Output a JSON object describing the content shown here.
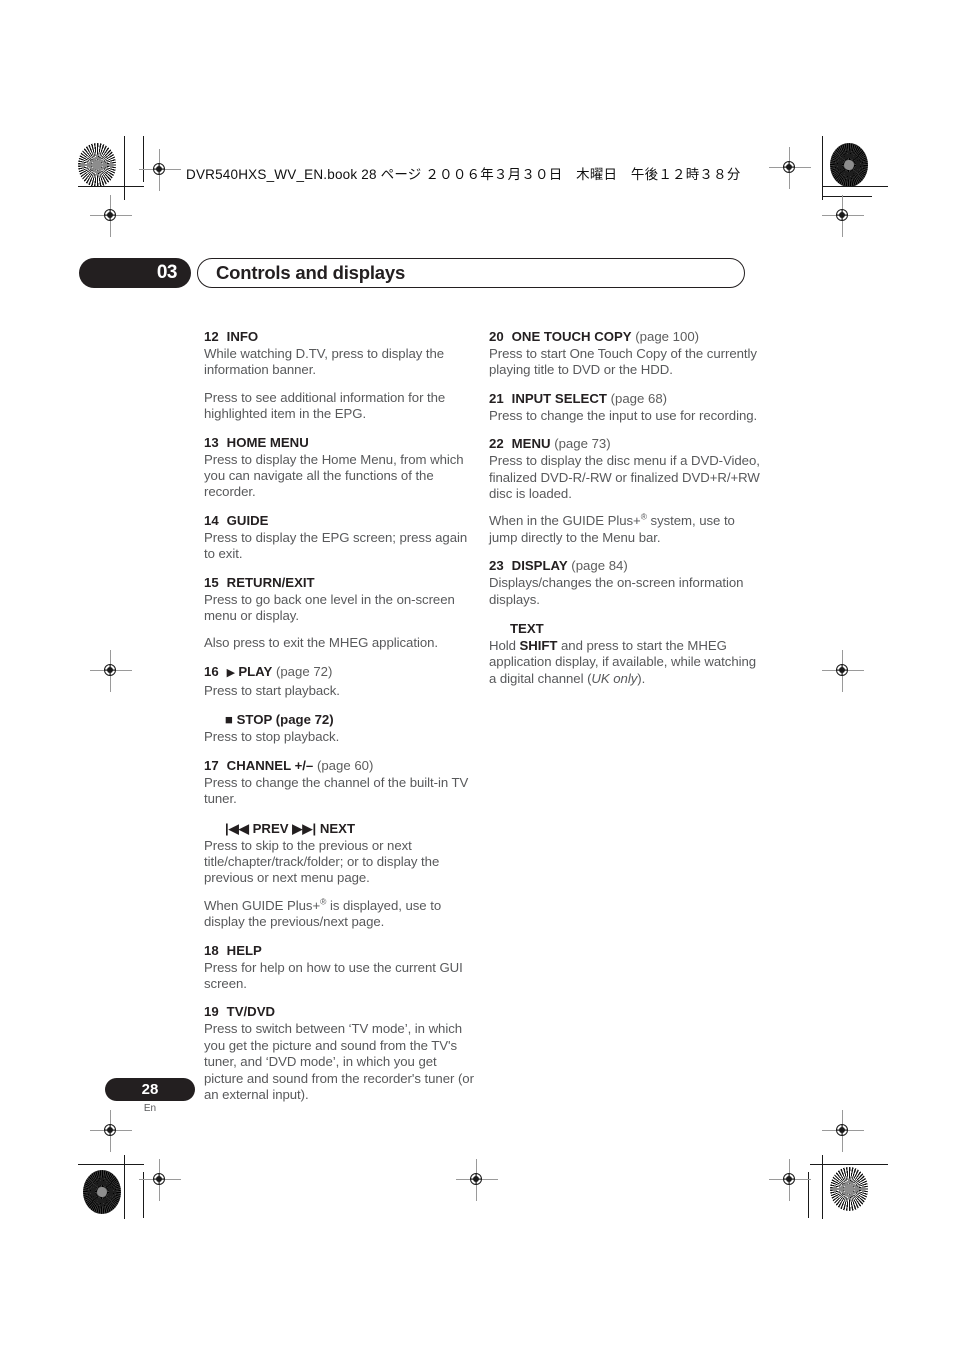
{
  "header": {
    "book_line": "DVR540HXS_WV_EN.book  28 ページ  ２００６年３月３０日　木曜日　午後１２時３８分"
  },
  "chapter": {
    "number": "03",
    "title": "Controls and displays"
  },
  "footer": {
    "page_number": "28",
    "language": "En"
  },
  "columns": {
    "left": [
      {
        "num": "12",
        "label": "INFO",
        "page_ref": "",
        "glyph": "",
        "indent": false,
        "paragraphs": [
          "While watching D.TV, press to display the information banner.",
          "Press to see additional information for the highlighted item in the EPG."
        ]
      },
      {
        "num": "13",
        "label": "HOME MENU",
        "page_ref": "",
        "glyph": "",
        "indent": false,
        "paragraphs": [
          "Press to display the Home Menu, from which you can navigate all the functions of the recorder."
        ]
      },
      {
        "num": "14",
        "label": "GUIDE",
        "page_ref": "",
        "glyph": "",
        "indent": false,
        "paragraphs": [
          "Press to display the EPG screen; press again to exit."
        ]
      },
      {
        "num": "15",
        "label": "RETURN/EXIT",
        "page_ref": "",
        "glyph": "",
        "indent": false,
        "paragraphs": [
          "Press to go back one level in the on-screen menu or display.",
          "Also press to exit the MHEG application."
        ]
      },
      {
        "num": "16",
        "label": "PLAY",
        "page_ref": "(page 72)",
        "glyph": "▶",
        "indent": true,
        "paragraphs": [
          "Press to start playback."
        ],
        "sub": [
          {
            "glyph": "■",
            "label": "STOP",
            "page_ref": "(page 72)",
            "paragraphs": [
              "Press to stop playback."
            ]
          }
        ]
      },
      {
        "num": "17",
        "label": "CHANNEL +/–",
        "page_ref": "(page 60)",
        "glyph": "",
        "indent": true,
        "paragraphs": [
          "Press to change the channel of the built-in TV tuner."
        ],
        "sub": [
          {
            "glyph": "",
            "label": "|◀◀ PREV   ▶▶| NEXT",
            "page_ref": "",
            "paragraphs": [
              "Press to skip to the previous or next title/chapter/track/folder; or to display the previous or next menu page.",
              "When GUIDE Plus+® is displayed, use to display the previous/next page."
            ]
          }
        ]
      },
      {
        "num": "18",
        "label": "HELP",
        "page_ref": "",
        "glyph": "",
        "indent": true,
        "paragraphs": [
          "Press for help on how to use the current GUI screen."
        ]
      },
      {
        "num": "19",
        "label": "TV/DVD",
        "page_ref": "",
        "glyph": "",
        "indent": true,
        "paragraphs": [
          "Press to switch between ‘TV mode’, in which you get the picture and sound from the TV's tuner, and ‘DVD mode’, in which you get picture and sound from the recorder's tuner (or an external input)."
        ]
      }
    ],
    "right": [
      {
        "num": "20",
        "label": "ONE TOUCH COPY",
        "page_ref": "(page 100)",
        "glyph": "",
        "indent": false,
        "paragraphs": [
          "Press to start One Touch Copy of the currently playing title to DVD or the HDD."
        ]
      },
      {
        "num": "21",
        "label": "INPUT SELECT",
        "page_ref": "(page 68)",
        "glyph": "",
        "indent": false,
        "paragraphs": [
          "Press to change the input to use for recording."
        ]
      },
      {
        "num": "22",
        "label": "MENU",
        "page_ref": "(page 73)",
        "glyph": "",
        "indent": false,
        "paragraphs": [
          "Press to display the disc menu if a DVD-Video, finalized DVD-R/-RW or finalized DVD+R/+RW disc is loaded.",
          "When in the GUIDE Plus+® system, use to jump directly to the Menu bar."
        ]
      },
      {
        "num": "23",
        "label": "DISPLAY",
        "page_ref": "(page 84)",
        "glyph": "",
        "indent": true,
        "paragraphs": [
          "Displays/changes the on-screen information displays."
        ],
        "sub": [
          {
            "glyph": "",
            "label": "TEXT",
            "page_ref": "",
            "paragraphs": [
              "Hold SHIFT and press to start the MHEG application display, if available, while watching a digital channel (UK only)."
            ]
          }
        ]
      }
    ]
  }
}
